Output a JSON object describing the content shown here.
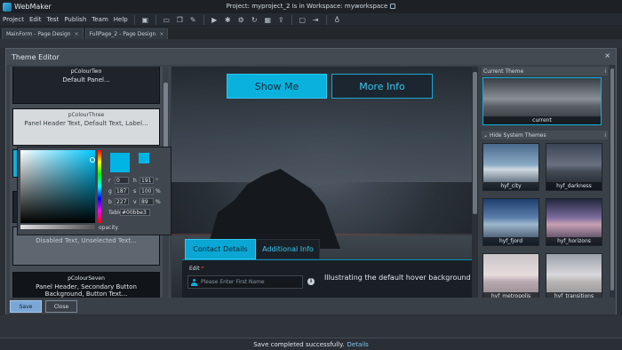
{
  "app": {
    "name": "WebMaker",
    "window_title": "Project: myproject_2 is in Workspace: myworkspace"
  },
  "menu": {
    "items": [
      "Project",
      "Edit",
      "Test",
      "Publish",
      "Team",
      "Help"
    ]
  },
  "toolbar": {
    "icons": [
      "save-icon",
      "monitor-icon",
      "copy-icon",
      "brush-icon",
      "play-icon",
      "bug-icon",
      "gear-icon",
      "refresh-icon",
      "grid-icon",
      "upload-icon",
      "lock-icon",
      "exit-icon",
      "bulb-icon"
    ]
  },
  "tabs": [
    {
      "label": "MainForm - Page Design",
      "close": "×"
    },
    {
      "label": "FullPage_2 - Page Design",
      "close": "×"
    }
  ],
  "theme_editor": {
    "title": "Theme Editor",
    "close": "×",
    "colours": [
      {
        "name": "pColourTwo",
        "desc": "Default Panel..."
      },
      {
        "name": "pColourThree",
        "desc": "Panel Header Text, Default Text, Label..."
      },
      {
        "name": "",
        "desc": "Disabled Text, Unselected Text..."
      },
      {
        "name": "pColourSeven",
        "desc": "Panel Header, Secondary Button Background, Button Text..."
      }
    ],
    "picker": {
      "r": "0",
      "g": "187",
      "b": "227",
      "h": "191",
      "s": "100",
      "v": "89",
      "h_unit": "°",
      "s_unit": "%",
      "v_unit": "%",
      "table_label": "Table",
      "table_value": "#00bbe3",
      "opacity_label": "opacity",
      "swatch_color": "#00b4e4"
    },
    "preview": {
      "show_me": "Show Me",
      "more_info": "More Info",
      "tab_active": "Contact Details",
      "tab_inactive": "Additional Info",
      "edit_label": "Edit",
      "required": "*",
      "name_placeholder": "Please Enter First Name",
      "info": "i",
      "hover_text": "Illustrating the default hover background co"
    },
    "themes": {
      "current_header": "Current Theme",
      "current_label": "current",
      "system_header": "Hide System Themes",
      "info": "i",
      "items": [
        "hyf_city",
        "hyf_darkness",
        "hyf_fjord",
        "hyf_horizons",
        "hyf_metropolis",
        "hyf_transitions"
      ]
    },
    "footer": {
      "save": "Save",
      "close": "Close"
    }
  },
  "status": {
    "message": "Save completed successfully.",
    "link": "Details"
  },
  "colors": {
    "accent": "#0ab1dd",
    "accent_border": "#31c6ee",
    "save_button": "#7aa7d6"
  }
}
